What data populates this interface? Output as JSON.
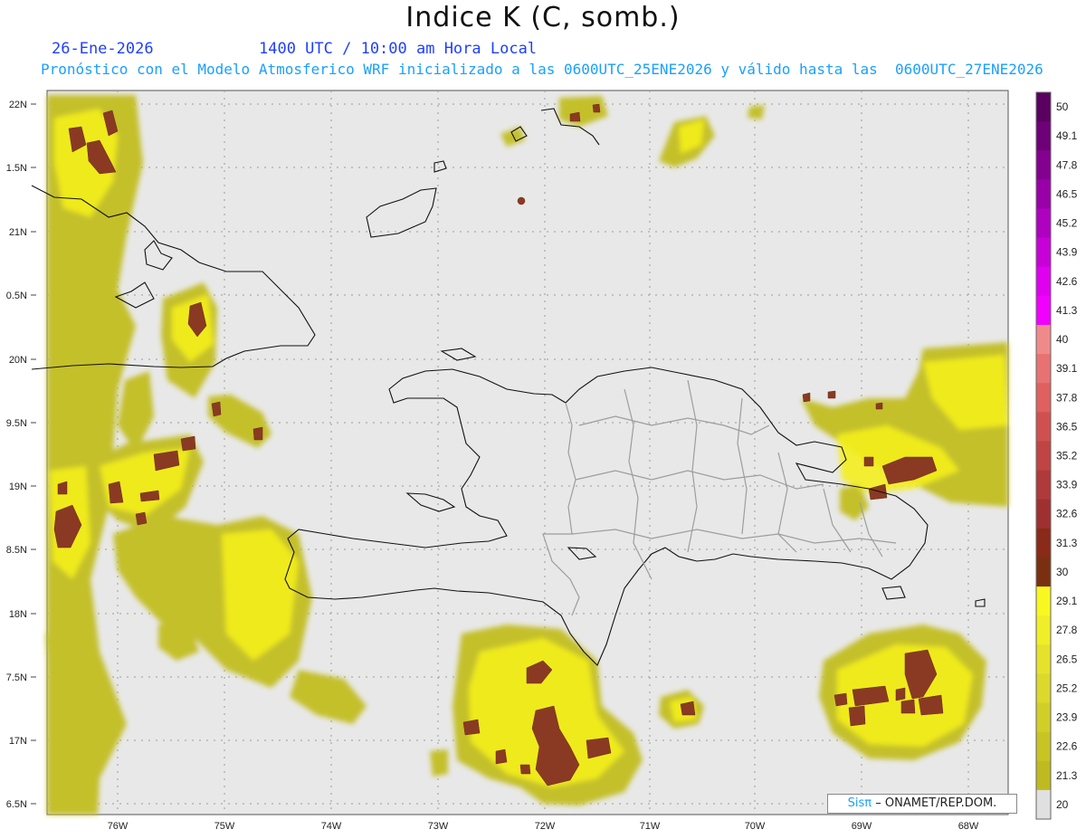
{
  "title": "Indice K (C, somb.)",
  "date": "26-Ene-2026",
  "time": "1400 UTC / 10:00 am Hora Local",
  "subtitle": "Pronóstico con el Modelo Atmosferico WRF inicializado a las 0600UTC_25ENE2026 y válido hasta las  0600UTC_27ENE2026",
  "credit": {
    "brand": "Sisπ",
    "rest": "– ONAMET/REP.DOM."
  },
  "axes": {
    "x_labels": [
      "76W",
      "75W",
      "74W",
      "73W",
      "72W",
      "71W",
      "70W",
      "69W",
      "68W"
    ],
    "y_labels": [
      "22N",
      "1.5N",
      "21N",
      "0.5N",
      "20N",
      "9.5N",
      "19N",
      "8.5N",
      "18N",
      "7.5N",
      "17N",
      "6.5N"
    ]
  },
  "colorbar": {
    "labels": [
      "50",
      "49.1",
      "47.8",
      "46.5",
      "45.2",
      "43.9",
      "42.6",
      "41.3",
      "40",
      "39.1",
      "37.8",
      "36.5",
      "35.2",
      "33.9",
      "32.6",
      "31.3",
      "30",
      "29.1",
      "27.8",
      "26.5",
      "25.2",
      "23.9",
      "22.6",
      "21.3",
      "20"
    ],
    "colors": [
      "#5a0060",
      "#6e0078",
      "#840090",
      "#9a00a8",
      "#b000c0",
      "#c800d8",
      "#e000f0",
      "#f000ff",
      "#f08a8a",
      "#e87272",
      "#e06060",
      "#d05050",
      "#c04444",
      "#b03a3a",
      "#a03030",
      "#8a2a18",
      "#7a3010",
      "#f8f820",
      "#f0ee28",
      "#e6e22c",
      "#dcd82c",
      "#d2ce28",
      "#c8c424",
      "#beba20",
      "#e0e0e0"
    ]
  },
  "colors": {
    "cool": "#bebc22",
    "warm": "#f6f11c",
    "hot": "#8a3a22",
    "land_bg": "#e8e8e8",
    "coast": "#111111",
    "border": "#999999"
  }
}
